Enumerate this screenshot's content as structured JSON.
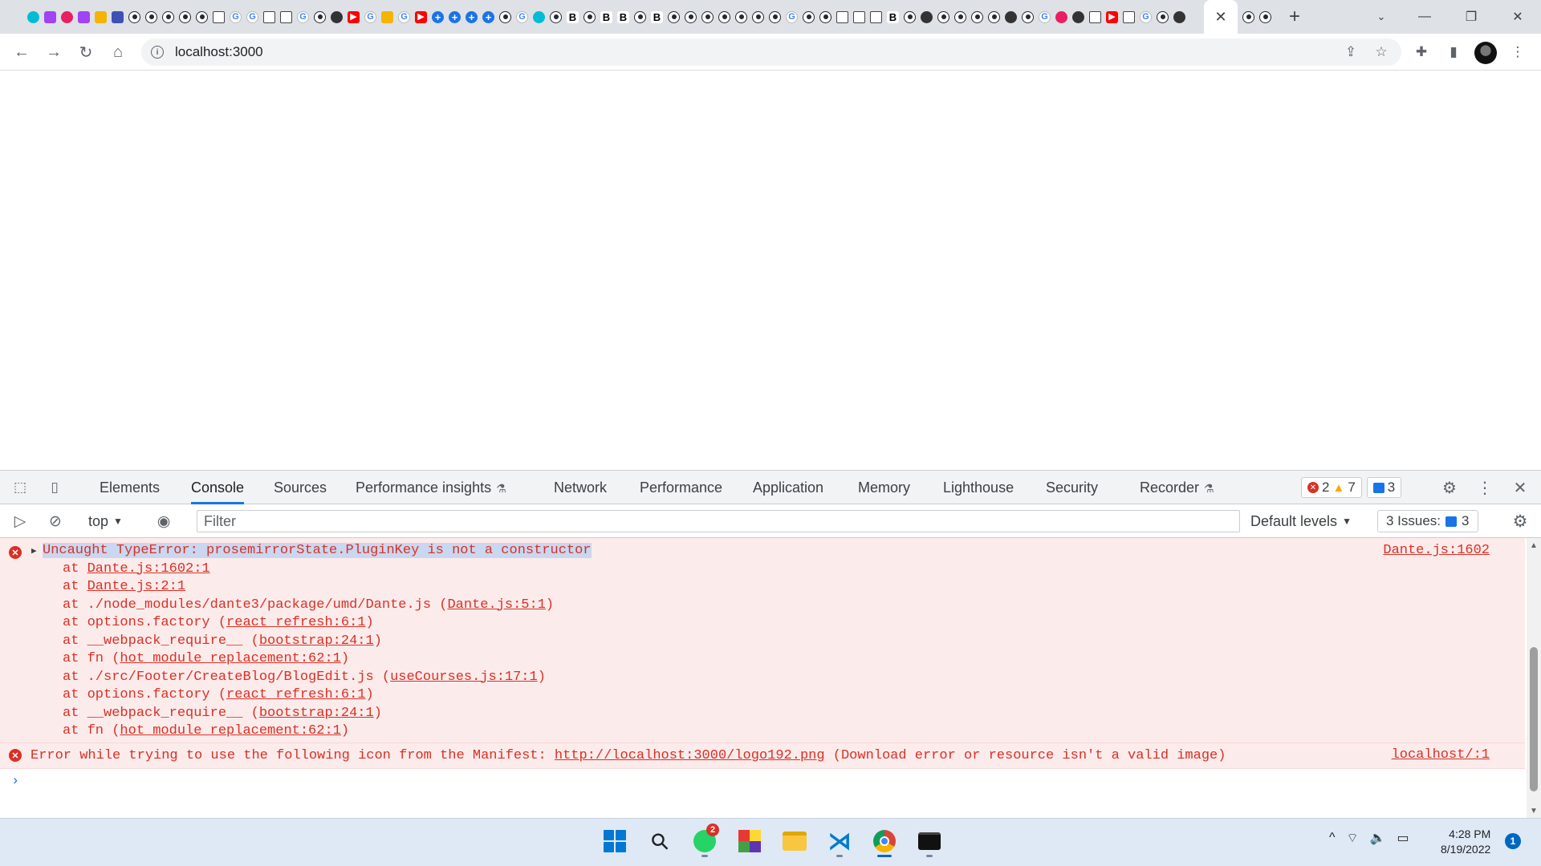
{
  "browser": {
    "active_tab_close": "✕",
    "new_tab": "+",
    "tab_search": "⌄",
    "window_controls": {
      "minimize": "—",
      "maximize": "❐",
      "close": "✕"
    },
    "favicon_strip": [
      "edge",
      "cyan",
      "purple",
      "pink",
      "purple",
      "orange",
      "navy",
      "gh",
      "gh",
      "gh",
      "gh",
      "gh",
      "doc",
      "g",
      "g",
      "doc",
      "doc",
      "g",
      "gh",
      "dark",
      "yt",
      "g",
      "orange",
      "g",
      "yt",
      "plus",
      "plus",
      "plus",
      "plus",
      "gh",
      "g",
      "cyan",
      "gh",
      "b",
      "gh",
      "b",
      "b",
      "gh",
      "b",
      "gh",
      "gh",
      "gh",
      "gh",
      "gh",
      "gh",
      "gh",
      "g",
      "gh",
      "gh",
      "doc",
      "doc",
      "doc",
      "b",
      "gh",
      "dark",
      "gh",
      "gh",
      "gh",
      "gh",
      "dark",
      "gh",
      "g",
      "pink",
      "dark",
      "doc",
      "yt",
      "doc",
      "g",
      "gh",
      "dark"
    ],
    "favicon_letters": {
      "g": "G",
      "b": "B",
      "plus": "+",
      "yt": "▶"
    },
    "extra_tabs": [
      "gh",
      "gh"
    ]
  },
  "toolbar": {
    "back_icon": "←",
    "forward_icon": "→",
    "reload_icon": "↻",
    "home_icon": "⌂",
    "info_icon": "i",
    "url": "localhost:3000",
    "share_icon": "⇪",
    "bookmark_icon": "☆",
    "extensions_icon": "✚",
    "sidepanel_icon": "▮",
    "menu_icon": "⋮"
  },
  "devtools": {
    "inspect_icon": "⬚",
    "device_icon": "▯",
    "tabs": [
      {
        "label": "Elements",
        "active": false
      },
      {
        "label": "Console",
        "active": true
      },
      {
        "label": "Sources",
        "active": false
      },
      {
        "label": "Performance insights",
        "active": false,
        "flask": true
      },
      {
        "label": "Network",
        "active": false
      },
      {
        "label": "Performance",
        "active": false
      },
      {
        "label": "Application",
        "active": false
      },
      {
        "label": "Memory",
        "active": false
      },
      {
        "label": "Lighthouse",
        "active": false
      },
      {
        "label": "Security",
        "active": false
      },
      {
        "label": "Recorder",
        "active": false,
        "flask": true
      }
    ],
    "flask_icon": "⚗",
    "error_count": "2",
    "warning_count": "7",
    "info_count": "3",
    "settings_icon": "⚙",
    "more_icon": "⋮",
    "close_icon": "✕",
    "console_toolbar": {
      "sidebar_icon": "▷",
      "clear_icon": "⊘",
      "context": "top",
      "dropdown_icon": "▼",
      "eye_icon": "◉",
      "filter_placeholder": "Filter",
      "levels": "Default levels",
      "issues_label": "3 Issues:",
      "issues_count": "3",
      "settings_icon": "⚙"
    },
    "messages": [
      {
        "type": "error",
        "title": "Uncaught TypeError: prosemirrorState.PluginKey is not a constructor",
        "source": "Dante.js:1602",
        "stack": [
          {
            "prefix": "at ",
            "fn": "",
            "link": "Dante.js:1602:1"
          },
          {
            "prefix": "at ",
            "fn": "",
            "link": "Dante.js:2:1"
          },
          {
            "prefix": "at ",
            "fn": "./node_modules/dante3/package/umd/Dante.js (",
            "link": "Dante.js:5:1",
            "suffix": ")"
          },
          {
            "prefix": "at ",
            "fn": "options.factory (",
            "link": "react refresh:6:1",
            "suffix": ")"
          },
          {
            "prefix": "at ",
            "fn": "__webpack_require__ (",
            "link": "bootstrap:24:1",
            "suffix": ")"
          },
          {
            "prefix": "at ",
            "fn": "fn (",
            "link": "hot module replacement:62:1",
            "suffix": ")"
          },
          {
            "prefix": "at ",
            "fn": "./src/Footer/CreateBlog/BlogEdit.js (",
            "link": "useCourses.js:17:1",
            "suffix": ")"
          },
          {
            "prefix": "at ",
            "fn": "options.factory (",
            "link": "react refresh:6:1",
            "suffix": ")"
          },
          {
            "prefix": "at ",
            "fn": "__webpack_require__ (",
            "link": "bootstrap:24:1",
            "suffix": ")"
          },
          {
            "prefix": "at ",
            "fn": "fn (",
            "link": "hot module replacement:62:1",
            "suffix": ")"
          }
        ]
      },
      {
        "type": "error",
        "text_before": "Error while trying to use the following icon from the Manifest: ",
        "link": "http://localhost:3000/logo192.png",
        "text_after": " (Download error or resource isn't a valid image)",
        "source": "localhost/:1"
      }
    ],
    "prompt": "›"
  },
  "taskbar": {
    "whatsapp_badge": "2",
    "search_icon": "⚲",
    "tray_chevron": "^",
    "wifi_icon": "⌔",
    "volume_icon": "🔈",
    "battery_icon": "▭",
    "time": "4:28 PM",
    "date": "8/19/2022",
    "notification_count": "1"
  },
  "colors": {
    "error_red": "#d93025",
    "error_bg": "#fcebeb",
    "accent_blue": "#1a73e8"
  }
}
